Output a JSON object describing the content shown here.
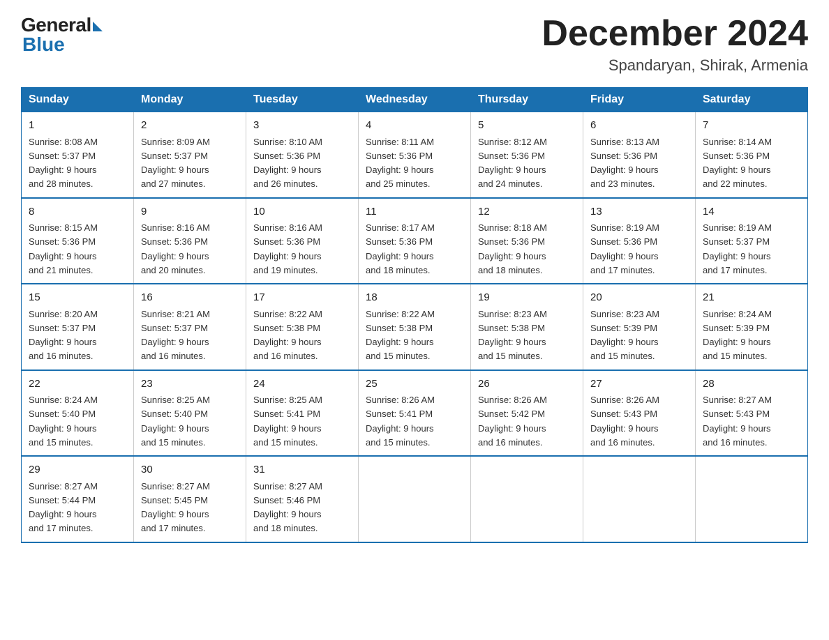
{
  "logo": {
    "general": "General",
    "blue": "Blue"
  },
  "title": "December 2024",
  "subtitle": "Spandaryan, Shirak, Armenia",
  "days_header": [
    "Sunday",
    "Monday",
    "Tuesday",
    "Wednesday",
    "Thursday",
    "Friday",
    "Saturday"
  ],
  "weeks": [
    [
      {
        "day": "1",
        "sunrise": "8:08 AM",
        "sunset": "5:37 PM",
        "daylight": "9 hours and 28 minutes."
      },
      {
        "day": "2",
        "sunrise": "8:09 AM",
        "sunset": "5:37 PM",
        "daylight": "9 hours and 27 minutes."
      },
      {
        "day": "3",
        "sunrise": "8:10 AM",
        "sunset": "5:36 PM",
        "daylight": "9 hours and 26 minutes."
      },
      {
        "day": "4",
        "sunrise": "8:11 AM",
        "sunset": "5:36 PM",
        "daylight": "9 hours and 25 minutes."
      },
      {
        "day": "5",
        "sunrise": "8:12 AM",
        "sunset": "5:36 PM",
        "daylight": "9 hours and 24 minutes."
      },
      {
        "day": "6",
        "sunrise": "8:13 AM",
        "sunset": "5:36 PM",
        "daylight": "9 hours and 23 minutes."
      },
      {
        "day": "7",
        "sunrise": "8:14 AM",
        "sunset": "5:36 PM",
        "daylight": "9 hours and 22 minutes."
      }
    ],
    [
      {
        "day": "8",
        "sunrise": "8:15 AM",
        "sunset": "5:36 PM",
        "daylight": "9 hours and 21 minutes."
      },
      {
        "day": "9",
        "sunrise": "8:16 AM",
        "sunset": "5:36 PM",
        "daylight": "9 hours and 20 minutes."
      },
      {
        "day": "10",
        "sunrise": "8:16 AM",
        "sunset": "5:36 PM",
        "daylight": "9 hours and 19 minutes."
      },
      {
        "day": "11",
        "sunrise": "8:17 AM",
        "sunset": "5:36 PM",
        "daylight": "9 hours and 18 minutes."
      },
      {
        "day": "12",
        "sunrise": "8:18 AM",
        "sunset": "5:36 PM",
        "daylight": "9 hours and 18 minutes."
      },
      {
        "day": "13",
        "sunrise": "8:19 AM",
        "sunset": "5:36 PM",
        "daylight": "9 hours and 17 minutes."
      },
      {
        "day": "14",
        "sunrise": "8:19 AM",
        "sunset": "5:37 PM",
        "daylight": "9 hours and 17 minutes."
      }
    ],
    [
      {
        "day": "15",
        "sunrise": "8:20 AM",
        "sunset": "5:37 PM",
        "daylight": "9 hours and 16 minutes."
      },
      {
        "day": "16",
        "sunrise": "8:21 AM",
        "sunset": "5:37 PM",
        "daylight": "9 hours and 16 minutes."
      },
      {
        "day": "17",
        "sunrise": "8:22 AM",
        "sunset": "5:38 PM",
        "daylight": "9 hours and 16 minutes."
      },
      {
        "day": "18",
        "sunrise": "8:22 AM",
        "sunset": "5:38 PM",
        "daylight": "9 hours and 15 minutes."
      },
      {
        "day": "19",
        "sunrise": "8:23 AM",
        "sunset": "5:38 PM",
        "daylight": "9 hours and 15 minutes."
      },
      {
        "day": "20",
        "sunrise": "8:23 AM",
        "sunset": "5:39 PM",
        "daylight": "9 hours and 15 minutes."
      },
      {
        "day": "21",
        "sunrise": "8:24 AM",
        "sunset": "5:39 PM",
        "daylight": "9 hours and 15 minutes."
      }
    ],
    [
      {
        "day": "22",
        "sunrise": "8:24 AM",
        "sunset": "5:40 PM",
        "daylight": "9 hours and 15 minutes."
      },
      {
        "day": "23",
        "sunrise": "8:25 AM",
        "sunset": "5:40 PM",
        "daylight": "9 hours and 15 minutes."
      },
      {
        "day": "24",
        "sunrise": "8:25 AM",
        "sunset": "5:41 PM",
        "daylight": "9 hours and 15 minutes."
      },
      {
        "day": "25",
        "sunrise": "8:26 AM",
        "sunset": "5:41 PM",
        "daylight": "9 hours and 15 minutes."
      },
      {
        "day": "26",
        "sunrise": "8:26 AM",
        "sunset": "5:42 PM",
        "daylight": "9 hours and 16 minutes."
      },
      {
        "day": "27",
        "sunrise": "8:26 AM",
        "sunset": "5:43 PM",
        "daylight": "9 hours and 16 minutes."
      },
      {
        "day": "28",
        "sunrise": "8:27 AM",
        "sunset": "5:43 PM",
        "daylight": "9 hours and 16 minutes."
      }
    ],
    [
      {
        "day": "29",
        "sunrise": "8:27 AM",
        "sunset": "5:44 PM",
        "daylight": "9 hours and 17 minutes."
      },
      {
        "day": "30",
        "sunrise": "8:27 AM",
        "sunset": "5:45 PM",
        "daylight": "9 hours and 17 minutes."
      },
      {
        "day": "31",
        "sunrise": "8:27 AM",
        "sunset": "5:46 PM",
        "daylight": "9 hours and 18 minutes."
      },
      null,
      null,
      null,
      null
    ]
  ],
  "labels": {
    "sunrise": "Sunrise:",
    "sunset": "Sunset:",
    "daylight": "Daylight:"
  }
}
